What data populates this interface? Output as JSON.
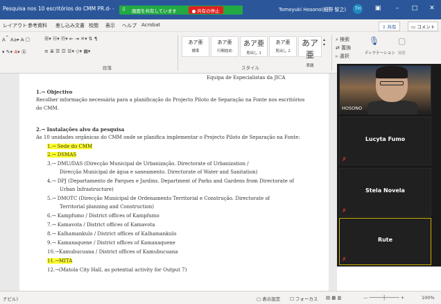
{
  "titlebar": {
    "doc_title": "Pesquisa nos 10 escritórios do CMM PR.d- - ...",
    "share_status": "画面を共有しています",
    "stop_label": "共有の停止",
    "user_name": "Tomoyuki Hosono(細野 智之)",
    "avatar_initials": "TH",
    "ribbon_display_icon": "ribbon-display-icon",
    "minimize_glyph": "–",
    "maximize_glyph": "□",
    "close_glyph": "✕"
  },
  "ribbon_tabs": [
    "レイアウト",
    "参考資料",
    "差し込み文書",
    "校閲",
    "表示",
    "ヘルプ",
    "Acrobat"
  ],
  "ribbon_actions": {
    "share": "共有",
    "comment": "コメント"
  },
  "ribbon": {
    "paragraph_label": "段落",
    "style_label": "スタイル",
    "styles": [
      {
        "preview": "あア亜",
        "name": "標準",
        "size": "normal"
      },
      {
        "preview": "あア亜",
        "name": "行間詰め",
        "size": "normal"
      },
      {
        "preview": "あア亜",
        "name": "見出し 1",
        "size": "big"
      },
      {
        "preview": "あア亜",
        "name": "見出し 2",
        "size": "normal"
      },
      {
        "preview": "あア亜",
        "name": "表題",
        "size": "biggest"
      }
    ],
    "search": "検索",
    "replace": "置換",
    "select": "選択",
    "dictate": "ディクテーション",
    "reuse": "秘匿"
  },
  "document": {
    "header_line": "Equipa de Especialistas da JICA",
    "sec1_title": "1.→ Objectivo",
    "sec1_line1": "Recolher informação necessária para a planificação do Projecto Piloto de Separação na Fonte nos escritórios",
    "sec1_line2": "do CMM.",
    "sec2_title": "2.→ Instalações alvo da pesquisa",
    "sec2_intro": "As 10 unidades orgânicas do CMM onde se planifica implementar o Projecto Piloto de Separação na Fonte:",
    "items": [
      {
        "text": "1.→ Sede do CMM",
        "highlight": true
      },
      {
        "text": "2.→ DSMAS",
        "highlight": true
      },
      {
        "text": "3.→ DMU/DAS (Direcção Municipal de Urbanização. Directorate of Urbanization /",
        "highlight": false
      },
      {
        "text": "Direcção Municipal de água e saneamento. Directorate of Water and Sanitation)",
        "highlight": false,
        "cont": true
      },
      {
        "text": "4.→ DPJ (Departamento de Parques e Jardins. Department of Parks and Gardens from Directorate of",
        "highlight": false
      },
      {
        "text": "Urban Infrastructure)",
        "highlight": false,
        "cont": true
      },
      {
        "text": "5.→ DMOTC (Direcção Municipal de Ordenamento Territorial e Construção. Directorate of",
        "highlight": false
      },
      {
        "text": "Territorial planning and Construction)",
        "highlight": false,
        "cont": true
      },
      {
        "text": "6.→ Kampfumo / District offices of Kampfumo",
        "highlight": false
      },
      {
        "text": "7.→ Kamavota / District offices of Kamavota",
        "highlight": false
      },
      {
        "text": "8.→ Kalhamankulo / District offices of Kalhamankulo",
        "highlight": false
      },
      {
        "text": "9.→ Kamaxaquene / District offices of Kamaxaquene",
        "highlight": false
      },
      {
        "text": "10.→Kamubucuana / District offices of Kamubucuana",
        "highlight": false
      },
      {
        "text": "11.→MITA",
        "highlight": true
      },
      {
        "text": "12.→(Matola City Hall, as potential activity for Output 7)",
        "highlight": false
      }
    ]
  },
  "participants": [
    {
      "name": "HOSONO",
      "video": true,
      "muted": false
    },
    {
      "name": "Lucyta Fumo",
      "video": false,
      "muted": true
    },
    {
      "name": "Stela Novela",
      "video": false,
      "muted": true
    },
    {
      "name": "Rute",
      "video": false,
      "muted": true
    }
  ],
  "statusbar": {
    "left": "ナビル)",
    "display_settings": "表示設定",
    "focus": "フォーカス",
    "zoom": "100%"
  }
}
